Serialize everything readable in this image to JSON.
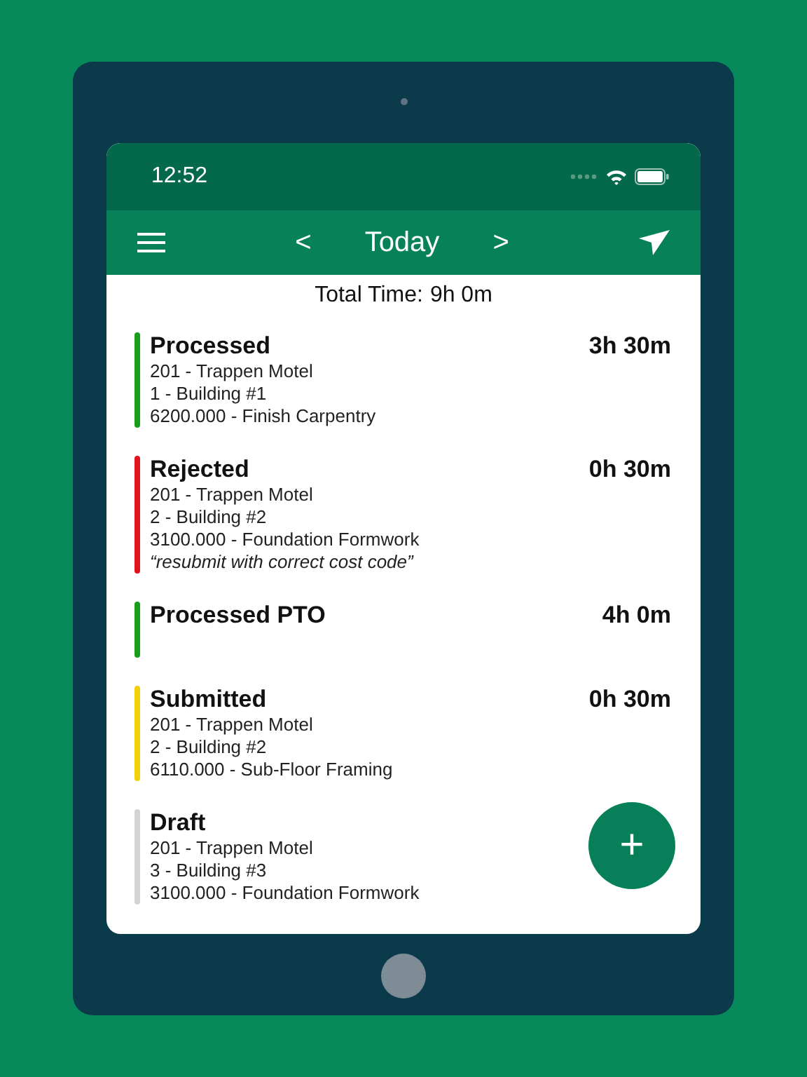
{
  "status_bar": {
    "time": "12:52"
  },
  "nav_bar": {
    "prev": "<",
    "title": "Today",
    "next": ">"
  },
  "total": {
    "label": "Total Time:",
    "value": "9h 0m"
  },
  "entries": [
    {
      "status": "Processed",
      "duration": "3h 30m",
      "color": "#1a9e1a",
      "lines": [
        "201 - Trappen Motel",
        "1 - Building #1",
        "6200.000 - Finish Carpentry"
      ]
    },
    {
      "status": "Rejected",
      "duration": "0h 30m",
      "color": "#e0141a",
      "lines": [
        "201 - Trappen Motel",
        "2 - Building #2",
        "3100.000 - Foundation Formwork"
      ],
      "note": "“resubmit with correct cost code”"
    },
    {
      "status": "Processed PTO",
      "duration": "4h 0m",
      "color": "#1a9e1a"
    },
    {
      "status": "Submitted",
      "duration": "0h 30m",
      "color": "#f2d10a",
      "lines": [
        "201 - Trappen Motel",
        "2 - Building #2",
        "6110.000 - Sub-Floor Framing"
      ]
    },
    {
      "status": "Draft",
      "color": "#d4d4d4",
      "lines": [
        "201 - Trappen Motel",
        "3 - Building #3",
        "3100.000 - Foundation Formwork"
      ]
    }
  ],
  "fab": {
    "label": "+"
  }
}
